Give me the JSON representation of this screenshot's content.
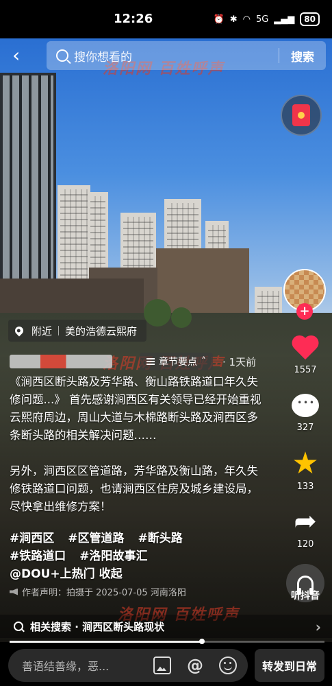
{
  "status_bar": {
    "time": "12:26",
    "network": "5G",
    "battery": "80"
  },
  "search": {
    "placeholder": "搜你想看的",
    "button": "搜索"
  },
  "watermark": {
    "text": "洛阳网 百姓呼声"
  },
  "location": {
    "prefix": "附近",
    "place": "美的浩德云熙府"
  },
  "post": {
    "chapter_label": "章节要点",
    "time": "1天前",
    "description": [
      "《涧西区断头路及芳华路、衡山路铁路道口年久失修问题...》 首先感谢涧西区有关领导已经开始重视云熙府周边，周山大道与木棉路断头路及涧西区多条断头路的相关解决问题……",
      "另外，涧西区区管道路，芳华路及衡山路，年久失修铁路道口问题，也请涧西区住房及城乡建设局，尽快拿出维修方案！"
    ],
    "tags": [
      "#涧西区",
      "#区管道路",
      "#断头路",
      "#铁路道口",
      "#洛阳故事汇",
      "@DOU+上热门"
    ],
    "collapse_label": "收起",
    "statement": "作者声明：拍摄于 2025-07-05 河南洛阳"
  },
  "actions": {
    "likes": "1557",
    "comments": "327",
    "favorites": "133",
    "shares": "120",
    "listen_label": "听抖音"
  },
  "related_search": {
    "text": "相关搜索 · 涧西区断头路现状"
  },
  "video_progress": 0.61,
  "bottom_bar": {
    "input_placeholder": "善语结善缘，恶...",
    "forward_button": "转发到日常"
  },
  "colors": {
    "like": "#fe2c55",
    "favorite": "#ffc300",
    "watermark": "#dc3c28"
  }
}
